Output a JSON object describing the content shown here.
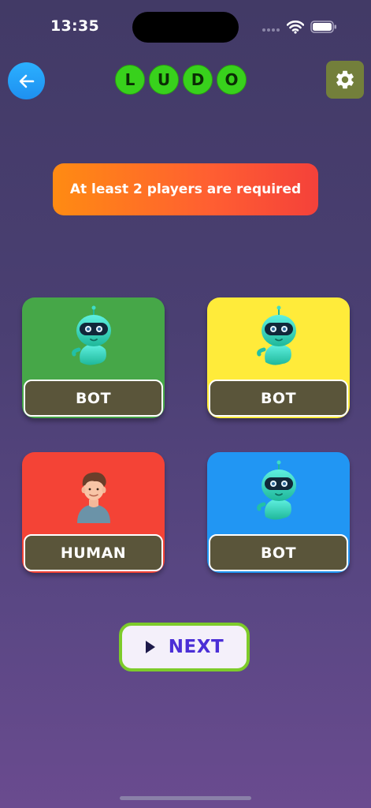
{
  "status_bar": {
    "time": "13:35"
  },
  "header": {
    "back_icon": "arrow-left-icon",
    "logo_letters": [
      "L",
      "U",
      "D",
      "O"
    ],
    "settings_icon": "gear-icon"
  },
  "banner": {
    "message": "At least 2 players are required"
  },
  "players": [
    {
      "color": "#46a748",
      "type": "BOT",
      "avatar": "robot-icon"
    },
    {
      "color": "#ffeb3a",
      "type": "BOT",
      "avatar": "robot-icon"
    },
    {
      "color": "#f44336",
      "type": "HUMAN",
      "avatar": "person-icon"
    },
    {
      "color": "#2196f3",
      "type": "BOT",
      "avatar": "robot-icon"
    }
  ],
  "next_button": {
    "label": "NEXT",
    "icon": "play-icon"
  },
  "colors": {
    "accent_green": "#38d11c",
    "next_text": "#4b2fd6",
    "next_border": "#7dcb2a",
    "back_button": "#1e90f0",
    "settings_button": "#737f3b"
  }
}
